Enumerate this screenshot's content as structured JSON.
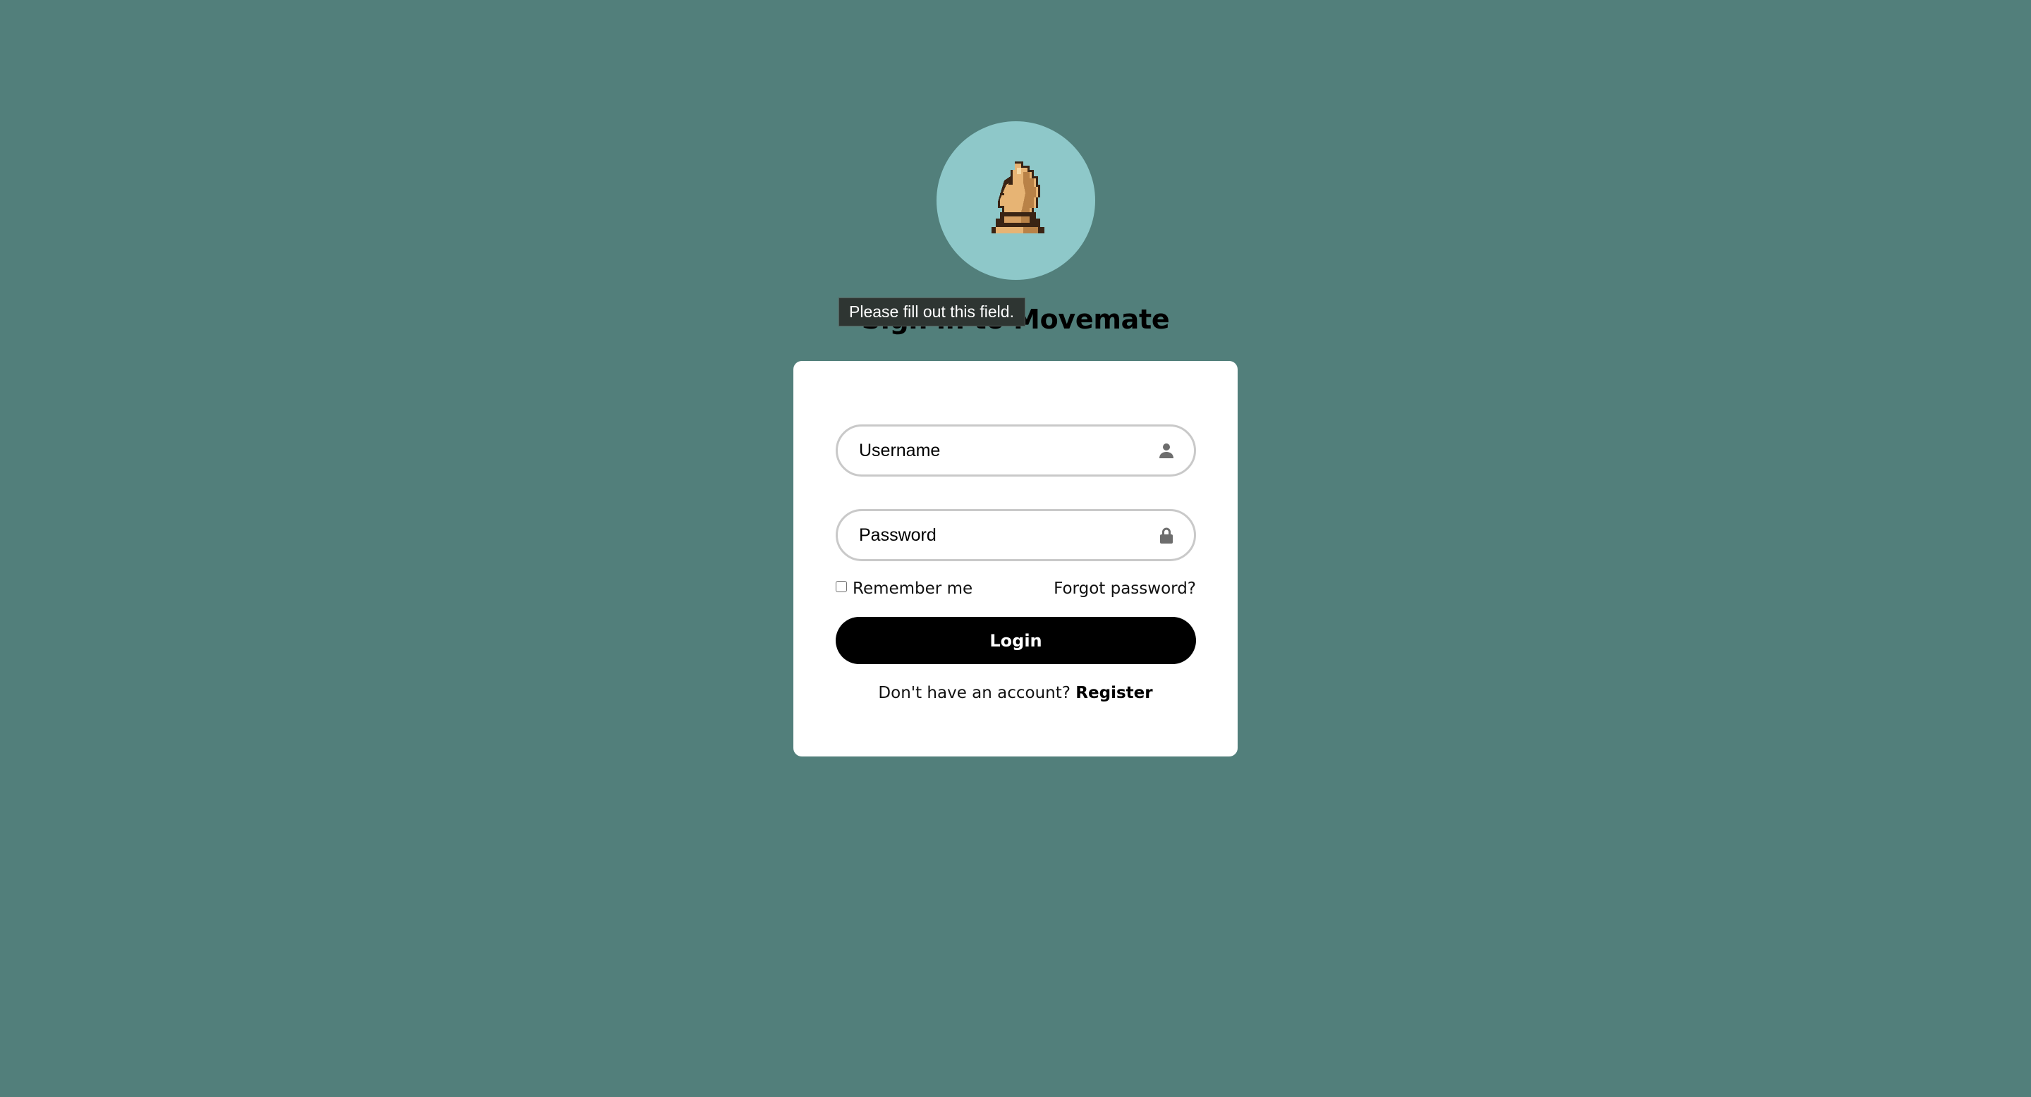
{
  "logo": {
    "icon": "chess-knight-icon",
    "circle_color": "#8ec8c9"
  },
  "page": {
    "title": "Sign in to Movemate",
    "background_color": "#527f7b"
  },
  "validation": {
    "tooltip": "Please fill out this field."
  },
  "form": {
    "username": {
      "placeholder": "Username",
      "value": "",
      "icon": "user-icon"
    },
    "password": {
      "placeholder": "Password",
      "value": "",
      "icon": "lock-icon"
    },
    "remember_me": {
      "label": "Remember me",
      "checked": false
    },
    "forgot_password": "Forgot password?",
    "login_button": "Login",
    "register_prompt": "Don't have an account?",
    "register_link": "Register"
  }
}
